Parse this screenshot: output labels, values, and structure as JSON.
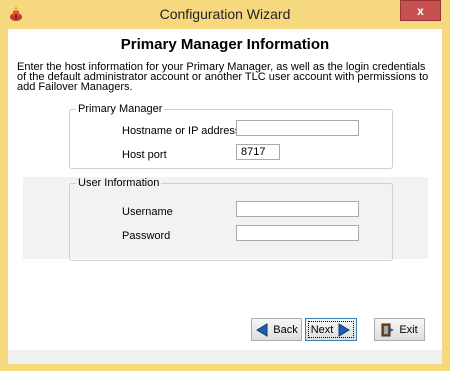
{
  "window": {
    "title": "Configuration Wizard",
    "close_glyph": "x"
  },
  "page": {
    "heading": "Primary Manager Information",
    "description": "Enter the host information for your Primary Manager, as well as the login credentials of the default administrator account or another TLC user account with permissions to add Failover Managers."
  },
  "primary_manager": {
    "legend": "Primary Manager",
    "hostname_label": "Hostname or IP address",
    "hostname_value": "",
    "port_label": "Host port",
    "port_value": "8717"
  },
  "user_info": {
    "legend": "User Information",
    "username_label": "Username",
    "username_value": "",
    "password_label": "Password",
    "password_value": ""
  },
  "buttons": {
    "back": "Back",
    "next": "Next",
    "exit": "Exit"
  },
  "colors": {
    "frame": "#f6d97e",
    "close": "#c75050",
    "arrow": "#1f5fae"
  },
  "icons": {
    "app": "wizard-app-icon",
    "back": "arrow-left-icon",
    "next": "arrow-right-icon",
    "exit": "exit-door-icon"
  }
}
